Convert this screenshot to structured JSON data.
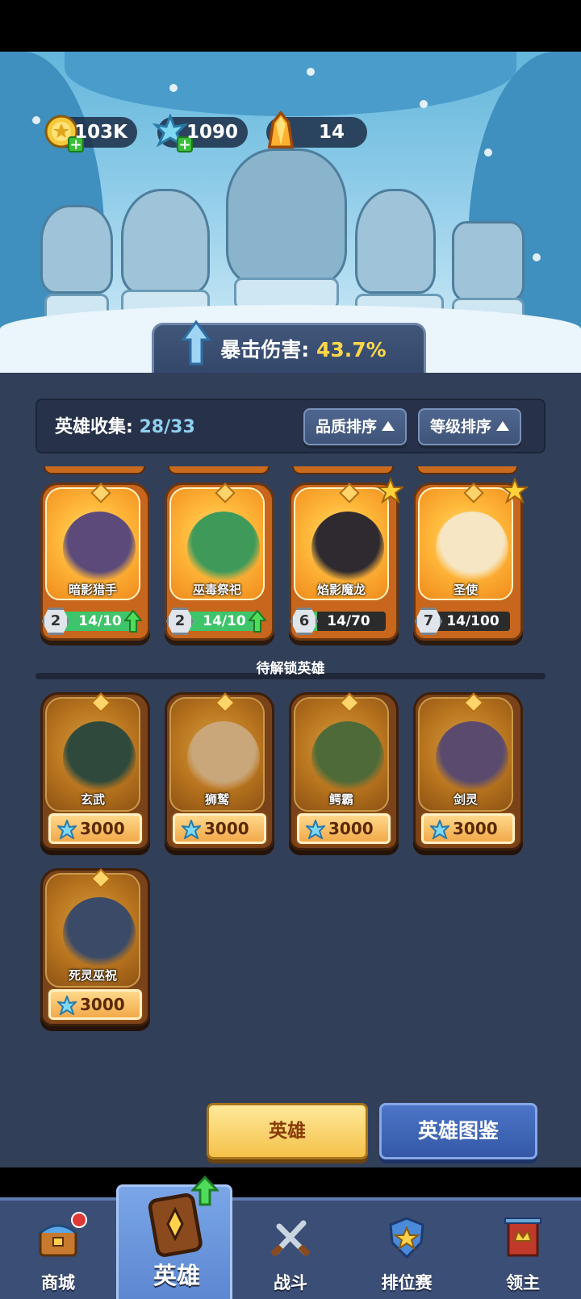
{
  "currencies": {
    "gold": "103K",
    "crystal": "1090",
    "shard": "14"
  },
  "buff": {
    "label": "暴击伤害:",
    "value": "43.7%"
  },
  "collection": {
    "label": "英雄收集:",
    "count": "28/33",
    "sort_quality": "品质排序",
    "sort_level": "等级排序"
  },
  "owned_heroes": [
    {
      "name": "暗影猎手",
      "level": "2",
      "progress": "14/10",
      "fill": 1.0,
      "can_upgrade": true,
      "starred": false,
      "color": "#5b4a7a"
    },
    {
      "name": "巫毒祭祀",
      "level": "2",
      "progress": "14/10",
      "fill": 1.0,
      "can_upgrade": true,
      "starred": false,
      "color": "#3f9a5a"
    },
    {
      "name": "焰影魔龙",
      "level": "6",
      "progress": "14/70",
      "fill": 0.2,
      "can_upgrade": false,
      "starred": true,
      "color": "#2e2a30"
    },
    {
      "name": "圣使",
      "level": "7",
      "progress": "14/100",
      "fill": 0.14,
      "can_upgrade": false,
      "starred": true,
      "color": "#f6e6c4"
    }
  ],
  "locked_section_title": "待解锁英雄",
  "locked_heroes": [
    {
      "name": "玄武",
      "price": "3000",
      "color": "#2f4a3c"
    },
    {
      "name": "狮鹫",
      "price": "3000",
      "color": "#c9a77a"
    },
    {
      "name": "鳄霸",
      "price": "3000",
      "color": "#4d6a38"
    },
    {
      "name": "剑灵",
      "price": "3000",
      "color": "#5a4a6e"
    },
    {
      "name": "死灵巫祝",
      "price": "3000",
      "color": "#3b4a66"
    }
  ],
  "actions": {
    "hero": "英雄",
    "codex": "英雄图鉴"
  },
  "nav": {
    "shop": "商城",
    "hero": "英雄",
    "battle": "战斗",
    "ranked": "排位赛",
    "lord": "领主"
  }
}
